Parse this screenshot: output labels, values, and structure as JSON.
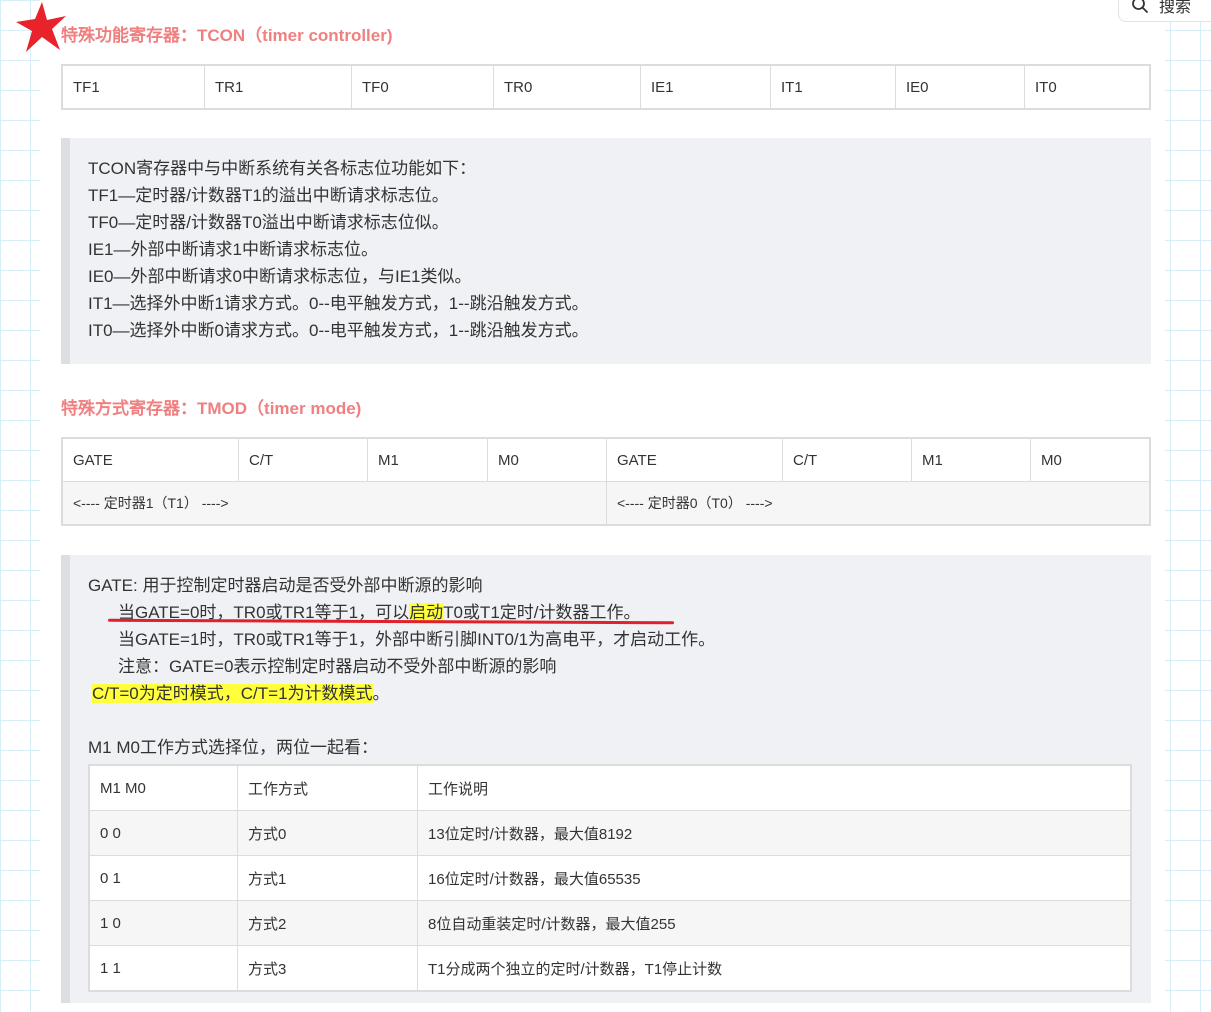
{
  "search": {
    "label": "搜索"
  },
  "tcon": {
    "heading": "特殊功能寄存器：TCON（timer controller)",
    "bits": [
      "TF1",
      "TR1",
      "TF0",
      "TR0",
      "IE1",
      "IT1",
      "IE0",
      "IT0"
    ],
    "notes": [
      "TCON寄存器中与中断系统有关各标志位功能如下：",
      "TF1—定时器/计数器T1的溢出中断请求标志位。",
      "TF0—定时器/计数器T0溢出中断请求标志位似。",
      "IE1—外部中断请求1中断请求标志位。",
      "IE0—外部中断请求0中断请求标志位，与IE1类似。",
      "IT1—选择外中断1请求方式。0--电平触发方式，1--跳沿触发方式。",
      "IT0—选择外中断0请求方式。0--电平触发方式，1--跳沿触发方式。"
    ]
  },
  "tmod": {
    "heading": "特殊方式寄存器：TMOD（timer mode)",
    "bits": [
      "GATE",
      "C/T",
      "M1",
      "M0",
      "GATE",
      "C/T",
      "M1",
      "M0"
    ],
    "timer1_label": "<----  定时器1（T1）  ---->",
    "timer0_label": "<----  定时器0（T0）  ---->",
    "gate_title": "GATE: 用于控制定时器启动是否受外部中断源的影响",
    "gate0_a": "当GATE=0时，TR0或TR1等于1，可以",
    "gate0_b": "启动",
    "gate0_c": "T0或T1定时/计数器工作。",
    "gate1": "当GATE=1时，TR0或TR1等于1，外部中断引脚INT0/1为高电平，才启动工作。",
    "gate_note": "注意：GATE=0表示控制定时器启动不受外部中断源的影响",
    "ct_a": "C/T=0为定时模式，C/T=1为计数模式",
    "ct_b": "。",
    "mode_intro": "M1 M0工作方式选择位，两位一起看：",
    "mode_headers": [
      "M1 M0",
      "工作方式",
      "工作说明"
    ],
    "modes": [
      {
        "bits": "0 0",
        "mode": "方式0",
        "desc": "13位定时/计数器，最大值8192"
      },
      {
        "bits": "0 1",
        "mode": "方式1",
        "desc": "16位定时/计数器，最大值65535"
      },
      {
        "bits": "1 0",
        "mode": "方式2",
        "desc": "8位自动重装定时/计数器，最大值255"
      },
      {
        "bits": "1 1",
        "mode": "方式3",
        "desc": "T1分成两个独立的定时/计数器，T1停止计数"
      }
    ]
  },
  "colors": {
    "heading": "#f08080",
    "highlight": "#ffff3c",
    "underline": "#e0202a",
    "star": "#e8232b"
  }
}
